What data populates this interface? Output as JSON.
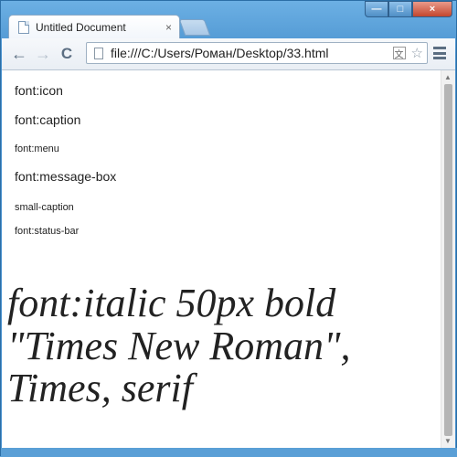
{
  "window": {
    "tab_title": "Untitled Document",
    "tab_close": "×",
    "controls": {
      "minimize": "—",
      "maximize": "□",
      "close": "×"
    }
  },
  "toolbar": {
    "back": "←",
    "forward": "→",
    "reload": "C",
    "url": "file:///C:/Users/Роман/Desktop/33.html",
    "translate_icon": "文",
    "star": "☆"
  },
  "content": {
    "line_icon": "font:icon",
    "line_caption": "font:caption",
    "line_menu": "font:menu",
    "line_message_box": "font:message-box",
    "line_small_caption": "small-caption",
    "line_status_bar": "font:status-bar",
    "big_text": "font:italic 50px bold \"Times New Roman\", Times, serif"
  },
  "scrollbar": {
    "up": "▲",
    "down": "▼"
  },
  "colors": {
    "frame": "#5aa1d8",
    "scroll_thumb": "#b5b5b5"
  }
}
